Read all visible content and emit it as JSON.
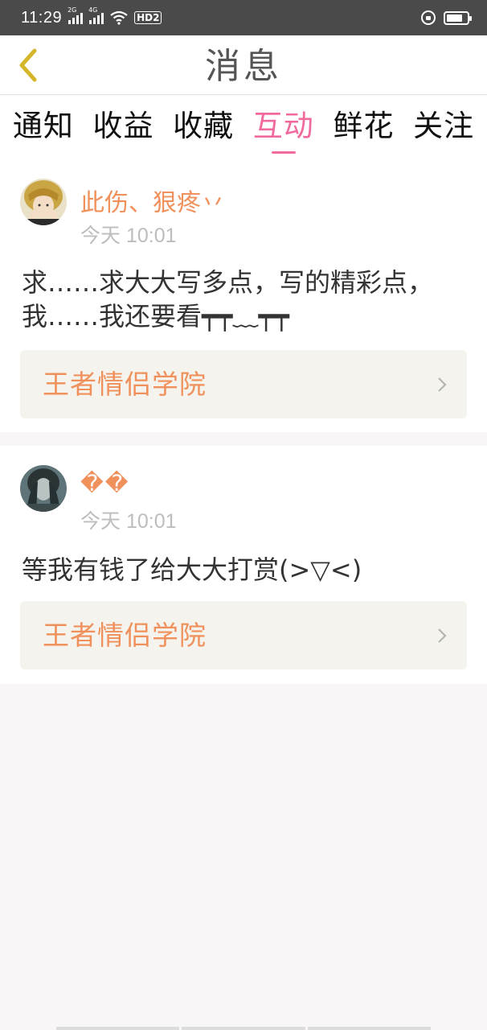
{
  "status_bar": {
    "time": "11:29",
    "sim1_label": "2G",
    "sim2_label": "4G",
    "hd_label": "HD2",
    "icons": [
      "signal-icon",
      "wifi-icon",
      "lock-icon",
      "battery-icon"
    ]
  },
  "header": {
    "title": "消息",
    "back_icon": "chevron-left-icon"
  },
  "tabs": [
    {
      "label": "通知",
      "active": false
    },
    {
      "label": "收益",
      "active": false
    },
    {
      "label": "收藏",
      "active": false
    },
    {
      "label": "互动",
      "active": true
    },
    {
      "label": "鲜花",
      "active": false
    },
    {
      "label": "关注",
      "active": false
    }
  ],
  "messages": [
    {
      "username": "此伤、狠疼丷",
      "time": "今天 10:01",
      "comment": "求……求大大写多点，写的精彩点，我……我还要看┯┯﹏┯┯",
      "book": "王者情侣学院"
    },
    {
      "username": "��",
      "time": "今天 10:01",
      "comment": "等我有钱了给大大打赏(>▽<)",
      "book": "王者情侣学院"
    }
  ],
  "colors": {
    "accent_pink": "#f06a9e",
    "accent_orange": "#f0905a",
    "status_bar_bg": "#4a4a4a"
  }
}
